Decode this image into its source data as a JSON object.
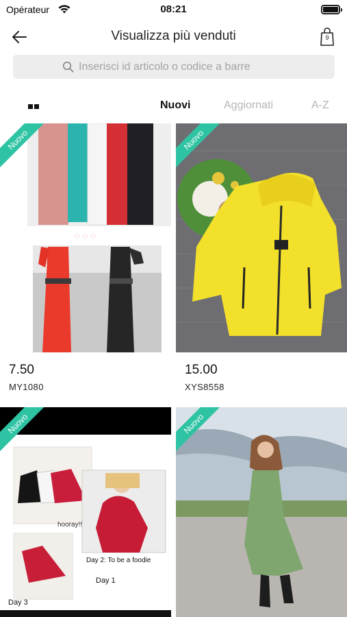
{
  "status_bar": {
    "carrier": "Opérateur",
    "time": "08:21"
  },
  "nav": {
    "title": "Visualizza più venduti",
    "cart_count": "9"
  },
  "search": {
    "placeholder": "Inserisci id articolo o codice a barre"
  },
  "sort": {
    "tabs": [
      {
        "label": "Nuovi",
        "active": true
      },
      {
        "label": "Aggiornati",
        "active": false
      },
      {
        "label": "A-Z",
        "active": false
      }
    ]
  },
  "products": [
    {
      "badge": "Nuovo",
      "price": "7.50",
      "sku": "MY1080",
      "image_hand_text": []
    },
    {
      "badge": "Nuovo",
      "price": "15.00",
      "sku": "XYS8558",
      "image_hand_text": []
    },
    {
      "badge": "Nuovo",
      "price": "",
      "sku": "",
      "image_hand_text": [
        "Day 1",
        "hooray!!",
        "Day 2: To be a foodie",
        "Day 3"
      ]
    },
    {
      "badge": "Nuovo",
      "price": "",
      "sku": "",
      "image_hand_text": []
    }
  ],
  "colors": {
    "badge": "#2ec4a3",
    "search_bg": "#ededed",
    "inactive_tab": "#b5b5b5"
  }
}
